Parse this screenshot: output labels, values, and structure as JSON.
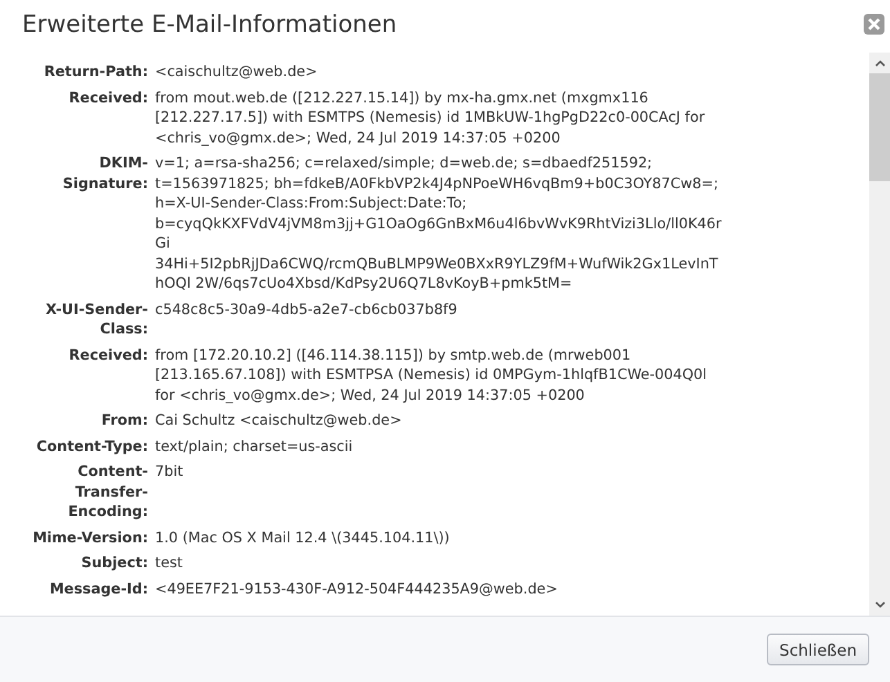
{
  "dialog": {
    "title": "Erweiterte E-Mail-Informationen"
  },
  "headers": [
    {
      "label": "Return-Path:",
      "value": "<caischultz@web.de>"
    },
    {
      "label": "Received:",
      "value": "from mout.web.de ([212.227.15.14]) by mx-ha.gmx.net (mxgmx116 [212.227.17.5]) with ESMTPS (Nemesis) id 1MBkUW-1hgPgD22c0-00CAcJ for <chris_vo@gmx.de>; Wed, 24 Jul 2019 14:37:05 +0200"
    },
    {
      "label": "DKIM-Signature:",
      "value": "v=1; a=rsa-sha256; c=relaxed/simple; d=web.de; s=dbaedf251592; t=1563971825; bh=fdkeB/A0FkbVP2k4J4pNPoeWH6vqBm9+b0C3OY87Cw8=; h=X-UI-Sender-Class:From:Subject:Date:To; b=cyqQkKXFVdV4jVM8m3jj+G1OaOg6GnBxM6u4l6bvWvK9RhtVizi3Llo/ll0K46rGi 34Hi+5I2pbRjJDa6CWQ/rcmQBuBLMP9We0BXxR9YLZ9fM+WufWik2Gx1LevInThOQl 2W/6qs7cUo4Xbsd/KdPsy2U6Q7L8vKoyB+pmk5tM="
    },
    {
      "label": "X-UI-Sender-Class:",
      "value": "c548c8c5-30a9-4db5-a2e7-cb6cb037b8f9"
    },
    {
      "label": "Received:",
      "value": "from [172.20.10.2] ([46.114.38.115]) by smtp.web.de (mrweb001 [213.165.67.108]) with ESMTPSA (Nemesis) id 0MPGym-1hlqfB1CWe-004Q0l for <chris_vo@gmx.de>; Wed, 24 Jul 2019 14:37:05 +0200"
    },
    {
      "label": "From:",
      "value": "Cai Schultz <caischultz@web.de>"
    },
    {
      "label": "Content-Type:",
      "value": "text/plain; charset=us-ascii"
    },
    {
      "label": "Content-Transfer-Encoding:",
      "value": "7bit"
    },
    {
      "label": "Mime-Version:",
      "value": "1.0 (Mac OS X Mail 12.4 \\(3445.104.11\\))"
    },
    {
      "label": "Subject:",
      "value": "test"
    },
    {
      "label": "Message-Id:",
      "value": "<49EE7F21-9153-430F-A912-504F444235A9@web.de>"
    }
  ],
  "buttons": [
    {
      "label": "Schließen"
    }
  ]
}
